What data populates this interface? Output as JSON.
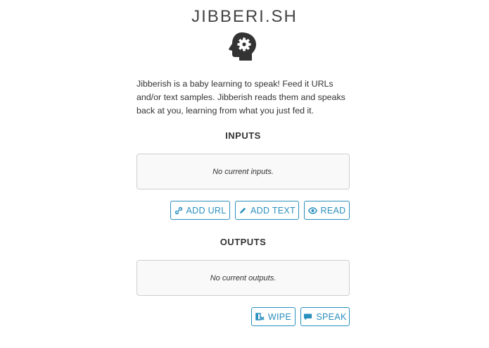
{
  "app": {
    "title": "JIBBERI.SH",
    "description": "Jibberish is a baby learning to speak! Feed it URLs and/or text samples. Jibberish reads them and speaks back at you, learning from what you just fed it."
  },
  "inputs": {
    "heading": "INPUTS",
    "empty_text": "No current inputs.",
    "buttons": {
      "add_url": "ADD URL",
      "add_text": "ADD TEXT",
      "read": "READ"
    }
  },
  "outputs": {
    "heading": "OUTPUTS",
    "empty_text": "No current outputs.",
    "buttons": {
      "wipe": "WIPE",
      "speak": "SPEAK"
    }
  },
  "icons": {
    "logo": "head-gear-icon",
    "add_url": "link-icon",
    "add_text": "pencil-icon",
    "read": "eye-icon",
    "wipe": "eraser-icon",
    "speak": "speech-bubble-icon"
  },
  "colors": {
    "accent": "#2a8fbd",
    "logo": "#333333",
    "panel_bg": "#f9f9f9",
    "panel_border": "#cfcfcf"
  }
}
